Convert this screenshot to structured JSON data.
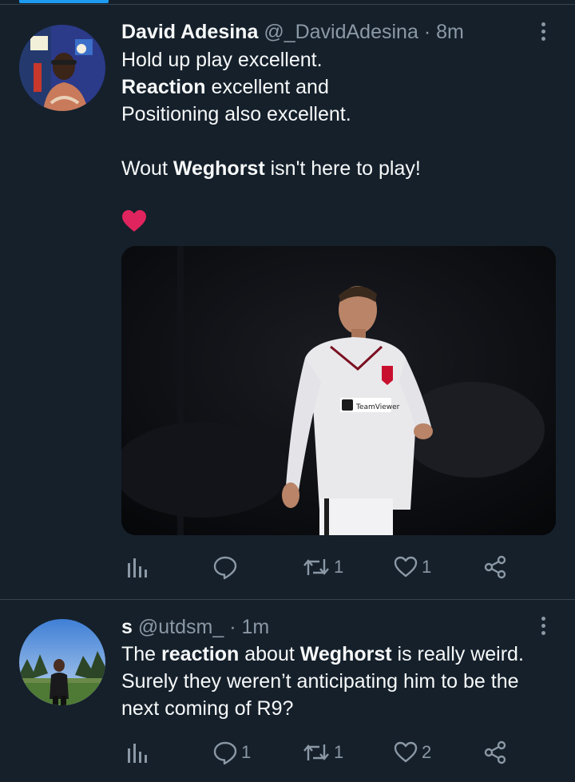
{
  "colors": {
    "background": "#15202b",
    "text": "#f7f9f9",
    "muted": "#8b98a5",
    "accent": "#1d9bf0",
    "divider": "#38444d",
    "heart_emoji": "#e0245e"
  },
  "tweets": [
    {
      "name": "David Adesina",
      "handle": "@_DavidAdesina",
      "separator": "·",
      "time": "8m",
      "text": {
        "line1": "Hold up play excellent.",
        "line2_bold": "Reaction",
        "line2_rest": " excellent and",
        "line3": "Positioning also excellent.",
        "line4_start": "Wout ",
        "line4_bold": "Weghorst",
        "line4_end": " isn't here to play!",
        "emoji": "❤️"
      },
      "media_alt_icon": "photo-footballer",
      "media": {
        "sponsor": "TeamViewer"
      },
      "actions": {
        "views_count": "",
        "reply_count": "",
        "retweet_count": "1",
        "like_count": "1"
      }
    },
    {
      "name": "s",
      "handle": "@utdsm_",
      "separator": "·",
      "time": "1m",
      "text": {
        "line1_start": "The ",
        "line1_bold1": "reaction",
        "line1_mid": " about ",
        "line1_bold2": "Weghorst",
        "line1_end": " is really weird.",
        "line2": "Surely they weren’t anticipating him to be the",
        "line3": "next coming of R9?"
      },
      "actions": {
        "views_count": "",
        "reply_count": "1",
        "retweet_count": "1",
        "like_count": "2"
      }
    }
  ]
}
